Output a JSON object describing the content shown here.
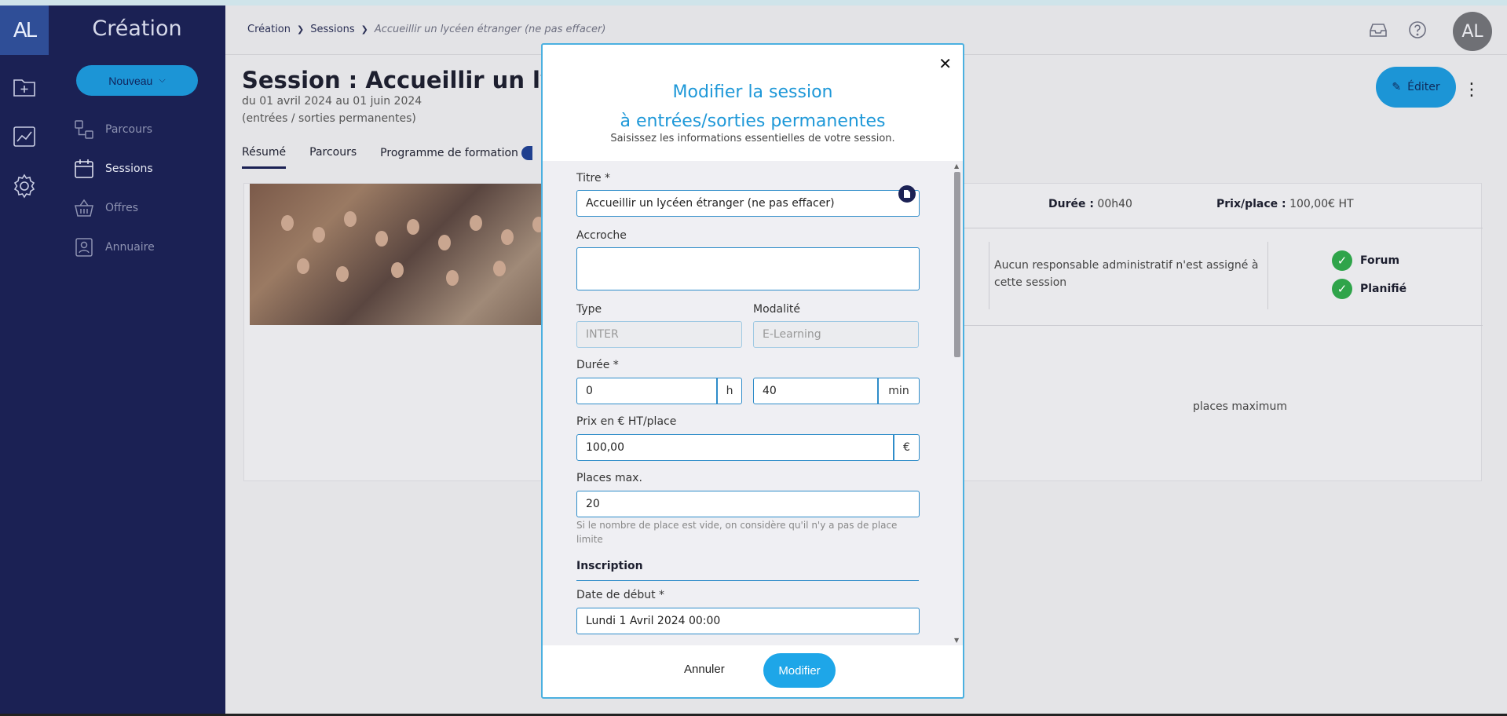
{
  "rail": {
    "logo": "AL"
  },
  "sidemenu": {
    "title": "Création",
    "new_button": "Nouveau",
    "items": [
      {
        "label": "Parcours"
      },
      {
        "label": "Sessions"
      },
      {
        "label": "Offres"
      },
      {
        "label": "Annuaire"
      }
    ]
  },
  "header": {
    "breadcrumb": [
      "Création",
      "Sessions",
      "Accueillir un lycéen étranger (ne pas effacer)"
    ],
    "avatar": "AL"
  },
  "page": {
    "title": "Session : Accueillir un lycé",
    "dates": "du 01 avril 2024 au 01 juin 2024",
    "mode": "(entrées / sorties permanentes)",
    "edit_button": "Éditer",
    "tabs": [
      "Résumé",
      "Parcours",
      "Programme de formation"
    ],
    "stats": {
      "duree_label": "Durée :",
      "duree_value": "00h40",
      "prix_label": "Prix/place :",
      "prix_value": "100,00€ HT"
    },
    "admin_note": "Aucun responsable administratif n'est assigné à cette session",
    "checks": [
      "Forum",
      "Planifié"
    ],
    "places_note": "places maximum"
  },
  "modal": {
    "title_line1": "Modifier la session",
    "title_line2": "à entrées/sorties permanentes",
    "subtitle": "Saisissez les informations essentielles de votre session.",
    "fields": {
      "titre_label": "Titre *",
      "titre_value": "Accueillir un lycéen étranger (ne pas effacer)",
      "accroche_label": "Accroche",
      "accroche_value": "",
      "type_label": "Type",
      "type_value": "INTER",
      "modalite_label": "Modalité",
      "modalite_value": "E-Learning",
      "duree_label": "Durée *",
      "duree_h": "0",
      "duree_h_unit": "h",
      "duree_min": "40",
      "duree_min_unit": "min",
      "prix_label": "Prix en € HT/place",
      "prix_value": "100,00",
      "prix_unit": "€",
      "places_label": "Places max.",
      "places_value": "20",
      "places_hint": "Si le nombre de place est vide, on considère qu'il n'y a pas de place limite",
      "inscription_heading": "Inscription",
      "date_debut_label": "Date de début *",
      "date_debut_value": "Lundi 1 Avril 2024 00:00"
    },
    "cancel_label": "Annuler",
    "submit_label": "Modifier"
  }
}
